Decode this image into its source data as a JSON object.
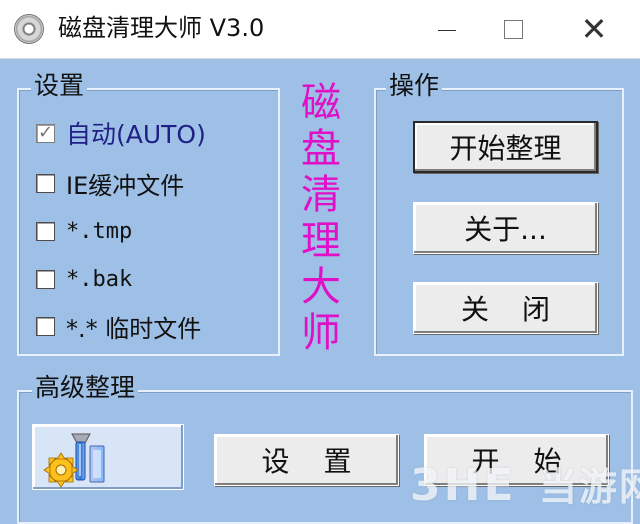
{
  "window": {
    "title": "磁盘清理大师 V3.0",
    "controls": {
      "minimize_icon": "minimize-icon",
      "maximize_icon": "maximize-icon",
      "close_icon": "close-icon",
      "close_symbol": "✕"
    }
  },
  "settings": {
    "title": "设置",
    "options": [
      {
        "label": "自动(AUTO)",
        "checked": true,
        "disabled": true
      },
      {
        "label": "IE缓冲文件",
        "checked": false
      },
      {
        "label": "*.tmp",
        "checked": false
      },
      {
        "label": "*.bak",
        "checked": false
      },
      {
        "label": "*.* 临时文件",
        "checked": false
      }
    ]
  },
  "brand_vertical": "磁盘清理大师",
  "actions": {
    "title": "操作",
    "start_cleanup": "开始整理",
    "about": "关于...",
    "close": "关闭"
  },
  "advanced": {
    "title": "高级整理",
    "settings": "设置",
    "start": "开始",
    "icon": "advanced-cleanup-icon"
  },
  "watermark": {
    "latin": "3HE",
    "chinese": "当游网"
  },
  "colors": {
    "background": "#9ec0e6",
    "title_accent": "#e010c8",
    "auto_label": "#1f1f86"
  }
}
